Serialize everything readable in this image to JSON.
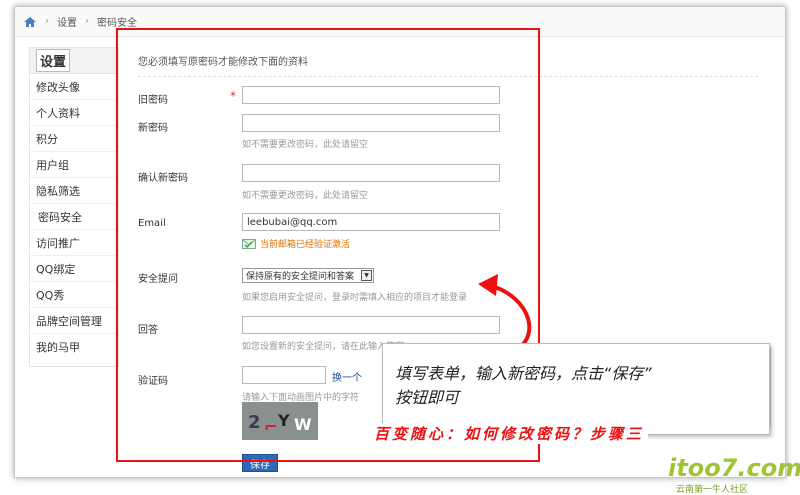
{
  "breadcrumb": {
    "home": "⌂",
    "item1": "设置",
    "item2": "密码安全"
  },
  "sidebar": {
    "title": "设置",
    "items": [
      {
        "label": "修改头像"
      },
      {
        "label": "个人资料"
      },
      {
        "label": "积分"
      },
      {
        "label": "用户组"
      },
      {
        "label": "隐私筛选"
      },
      {
        "label": "密码安全"
      },
      {
        "label": "访问推广"
      },
      {
        "label": "QQ绑定"
      },
      {
        "label": "QQ秀"
      },
      {
        "label": "品牌空间管理"
      },
      {
        "label": "我的马甲"
      }
    ]
  },
  "form": {
    "notice": "您必须填写原密码才能修改下面的资料",
    "old_password_label": "旧密码",
    "required_mark": "*",
    "new_password_label": "新密码",
    "new_password_hint": "如不需要更改密码，此处请留空",
    "confirm_password_label": "确认新密码",
    "confirm_password_hint": "如不需要更改密码，此处请留空",
    "email_label": "Email",
    "email_value": "leebubai@qq.com",
    "email_status": "当前邮箱已经验证激活",
    "security_question_label": "安全提问",
    "security_question_value": "保持原有的安全提问和答案",
    "security_question_hint": "如果您启用安全提问，登录时需填入相应的项目才能登录",
    "answer_label": "回答",
    "answer_hint": "如您设置新的安全提问，请在此输入答案",
    "captcha_label": "验证码",
    "captcha_change": "换一个",
    "captcha_hint": "请输入下面动画图片中的字符",
    "captcha_image_text": "2 Y W",
    "save_button": "保存"
  },
  "annotation": {
    "line1": "填写表单，输入新密码，点击“保存”",
    "line2": "按钮即可",
    "step": "百变随心：如何修改密码？步骤三"
  },
  "watermark": {
    "main": "itoo7.com",
    "sub": "云南第一牛人社区"
  },
  "colors": {
    "highlight": "#ee1111",
    "link": "#1a4e9c",
    "save": "#2e68b8",
    "ok": "#e07000"
  }
}
